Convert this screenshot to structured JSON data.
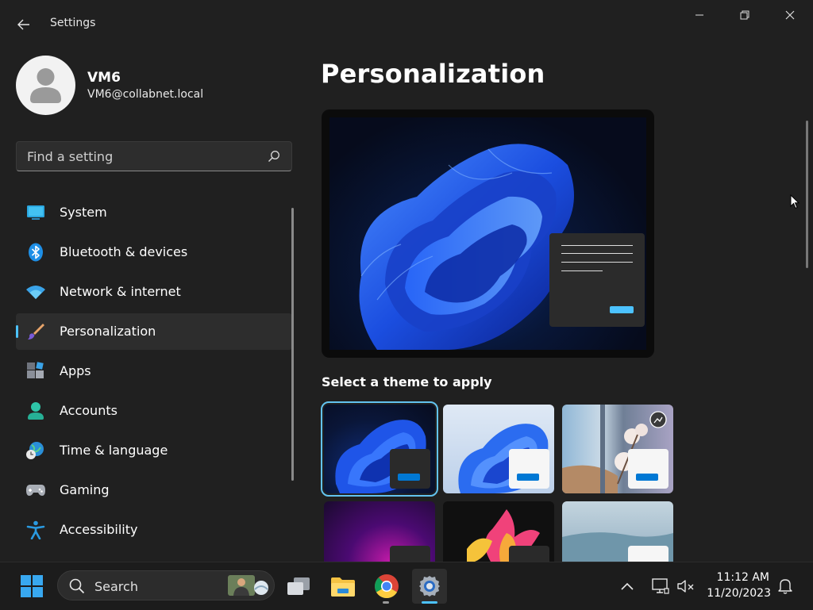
{
  "window": {
    "title": "Settings"
  },
  "profile": {
    "name": "VM6",
    "email": "VM6@collabnet.local"
  },
  "search": {
    "placeholder": "Find a setting"
  },
  "sidebar": {
    "items": [
      {
        "label": "System",
        "icon": "system-icon"
      },
      {
        "label": "Bluetooth & devices",
        "icon": "bluetooth-icon"
      },
      {
        "label": "Network & internet",
        "icon": "wifi-icon"
      },
      {
        "label": "Personalization",
        "icon": "brush-icon",
        "selected": true
      },
      {
        "label": "Apps",
        "icon": "apps-icon"
      },
      {
        "label": "Accounts",
        "icon": "accounts-icon"
      },
      {
        "label": "Time & language",
        "icon": "time-language-icon"
      },
      {
        "label": "Gaming",
        "icon": "gamepad-icon"
      },
      {
        "label": "Accessibility",
        "icon": "accessibility-icon"
      }
    ]
  },
  "main": {
    "title": "Personalization",
    "themes_label": "Select a theme to apply",
    "themes": [
      {
        "name": "windows-dark",
        "selected": true
      },
      {
        "name": "windows-light"
      },
      {
        "name": "glow-flower"
      },
      {
        "name": "purple-glow"
      },
      {
        "name": "captured-motion"
      },
      {
        "name": "flow"
      }
    ]
  },
  "taskbar": {
    "search_label": "Search",
    "apps": [
      "file-explorer-icon",
      "chrome-icon",
      "settings-icon"
    ],
    "time": "11:12 AM",
    "date": "11/20/2023"
  },
  "colors": {
    "accent": "#4cc2ff",
    "button_blue": "#0078d4",
    "background": "#202020"
  }
}
